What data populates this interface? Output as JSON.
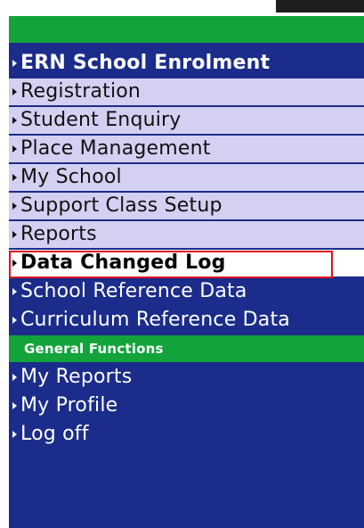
{
  "theme": {
    "navy": "#1b2c8a",
    "green": "#13a33b",
    "lavender": "#d4d0f2",
    "highlight_red": "#e0101e"
  },
  "menu": {
    "header": "ERN School Enrolment",
    "items": [
      {
        "label": "Registration"
      },
      {
        "label": "Student Enquiry"
      },
      {
        "label": "Place Management"
      },
      {
        "label": "My School"
      },
      {
        "label": "Support Class Setup"
      },
      {
        "label": "Reports"
      }
    ],
    "selected": {
      "label": "Data Changed Log"
    },
    "dark_items": [
      {
        "label": "School Reference Data"
      },
      {
        "label": "Curriculum Reference Data"
      }
    ]
  },
  "general_functions": {
    "title": "General Functions",
    "items": [
      {
        "label": "My Reports"
      },
      {
        "label": "My Profile"
      },
      {
        "label": "Log off"
      }
    ]
  },
  "icons": {
    "arrow": "triangle-right-icon"
  }
}
